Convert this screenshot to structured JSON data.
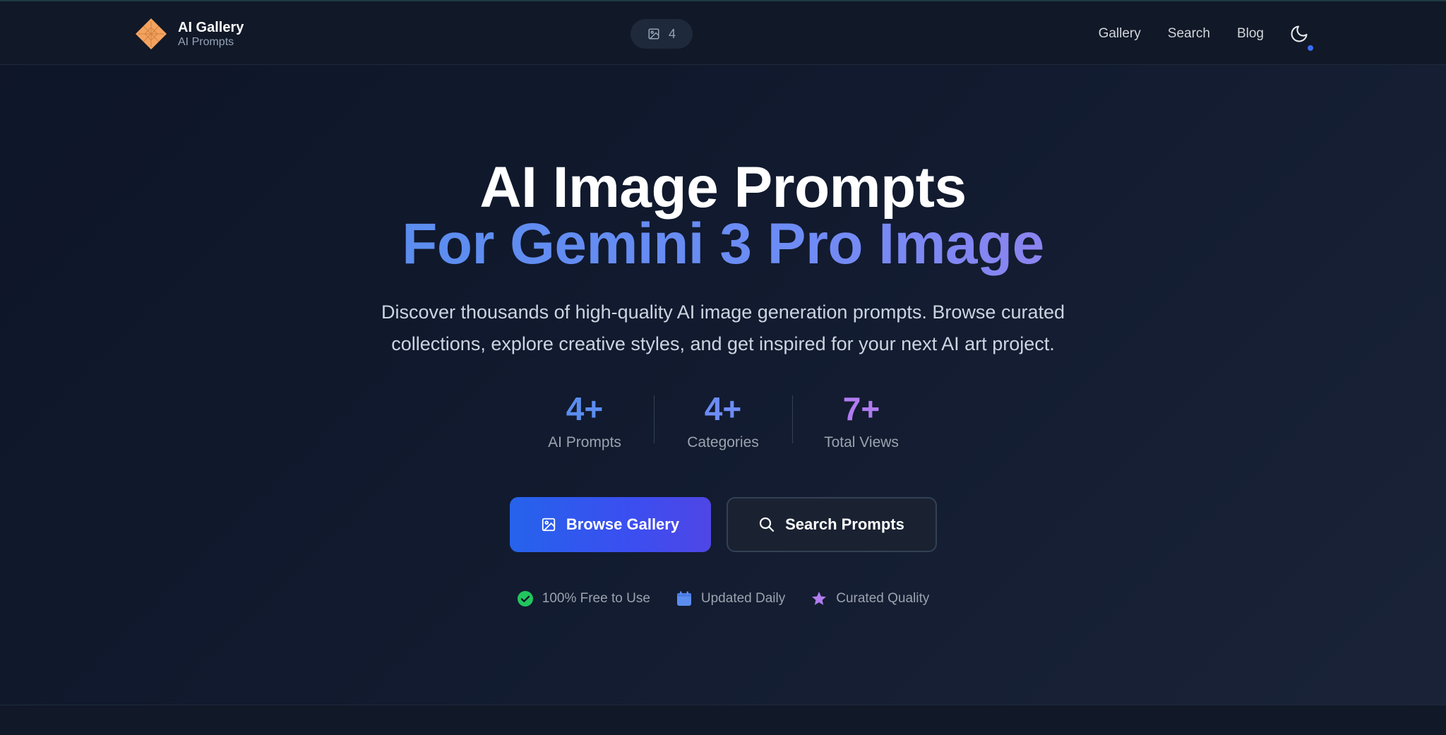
{
  "header": {
    "logo_title": "AI Gallery",
    "logo_subtitle": "AI Prompts",
    "image_count": "4",
    "nav": [
      "Gallery",
      "Search",
      "Blog"
    ]
  },
  "hero": {
    "title_line1": "AI Image Prompts",
    "title_line2": "For Gemini 3 Pro Image",
    "subtitle_line1": "Discover thousands of high-quality AI image generation prompts. Browse curated",
    "subtitle_line2": "collections, explore creative styles, and get inspired for your next AI art project."
  },
  "stats": [
    {
      "value": "4+",
      "label": "AI Prompts",
      "color": "#5b8def"
    },
    {
      "value": "4+",
      "label": "Categories",
      "color": "#6d8cf5"
    },
    {
      "value": "7+",
      "label": "Total Views",
      "color": "#b07cf0"
    }
  ],
  "buttons": {
    "browse": "Browse Gallery",
    "search": "Search Prompts"
  },
  "features": [
    {
      "label": "100% Free to Use",
      "icon": "check-circle-icon",
      "color": "#22c55e"
    },
    {
      "label": "Updated Daily",
      "icon": "calendar-icon",
      "color": "#5b8def"
    },
    {
      "label": "Curated Quality",
      "icon": "star-icon",
      "color": "#b07cf0"
    }
  ],
  "colors": {
    "accent_blue": "#2563eb",
    "accent_purple": "#8b84f0",
    "background": "#0e1528"
  }
}
